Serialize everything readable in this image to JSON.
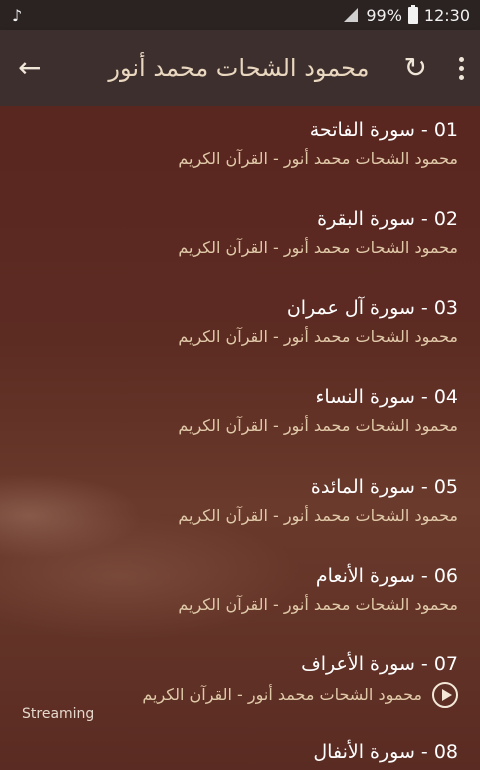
{
  "status": {
    "music_icon": "♪",
    "battery": "99%",
    "time": "12:30"
  },
  "appbar": {
    "back_icon": "←",
    "title": "محمود الشحات محمد أنور",
    "refresh_icon": "↻"
  },
  "items": [
    {
      "title": "01 - سورة الفاتحة",
      "subtitle": "محمود الشحات محمد أنور - القرآن الكريم"
    },
    {
      "title": "02 - سورة البقرة",
      "subtitle": "محمود الشحات محمد أنور - القرآن الكريم"
    },
    {
      "title": "03 - سورة آل عمران",
      "subtitle": "محمود الشحات محمد أنور - القرآن الكريم"
    },
    {
      "title": "04 - سورة النساء",
      "subtitle": "محمود الشحات محمد أنور - القرآن الكريم"
    },
    {
      "title": "05 - سورة المائدة",
      "subtitle": "محمود الشحات محمد أنور - القرآن الكريم"
    },
    {
      "title": "06 - سورة الأنعام",
      "subtitle": "محمود الشحات محمد أنور - القرآن الكريم"
    },
    {
      "title": "07 - سورة الأعراف",
      "subtitle": "محمود الشحات محمد أنور - القرآن الكريم",
      "playing": true
    },
    {
      "title": "08 - سورة الأنفال",
      "subtitle": ""
    }
  ],
  "streaming_label": "Streaming"
}
